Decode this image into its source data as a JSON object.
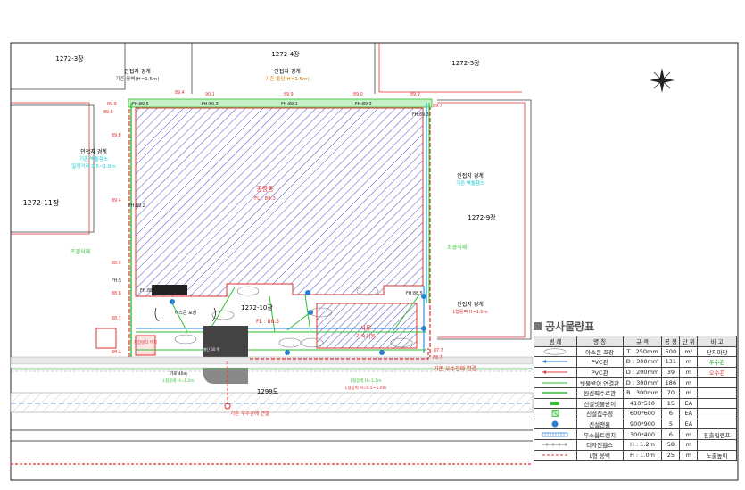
{
  "lots": {
    "lot_3": "1272-3장",
    "lot_4": "1272-4장",
    "lot_5": "1272-5장",
    "lot_11": "1272-11장",
    "lot_9": "1272-9장",
    "lot_10": "1272-10장",
    "road": "1299도"
  },
  "boundaries": {
    "top_center_title": "인접지 경계",
    "top_center_sub": "기존 돌담(H=1.5m)",
    "top_left_title": "인접지 경계",
    "top_left_sub": "기존 옹벽(H=1.5m)",
    "left_title": "인접지 경계",
    "left_sub1": "기존 벽돌휀스",
    "left_sub2": "일정거리 0.5~1.0m",
    "right_title": "인접지 경계",
    "right_sub": "기존 벽돌휀스",
    "right_lower_title": "인접지 경계",
    "right_lower_sub": "L형옹벽 H=1.0m"
  },
  "buildings": {
    "factory_name": "공장동",
    "factory_fl": "FL : 89.3",
    "office_name": "사무",
    "office_sub": "기숙사동",
    "site_fl": "FL : 88.3",
    "ascon": "아스콘 포장",
    "landscape_left": "조경식재",
    "landscape_right": "조경식재",
    "small_box": "저장탱크 부지",
    "drain_connect": "기존 우수관에 연결",
    "drain_bottom": "기존 우수관에 연결",
    "gate_left1": "가로 40m",
    "gate_left2": "L형옹벽 H=1.2m",
    "gate_right1": "L형옹벽 H=1.2m",
    "gate_right2": "L형옹벽 H=0.5~1.0m",
    "stair_note": "계단 60 폭"
  },
  "elevations": {
    "fh_top_left": "FH:89.5",
    "fh_top_2": "FH:89.3",
    "fh_top_3": "FH:89.1",
    "fh_top_4": "FH:89.3",
    "fh_top_right": "FH:89.3",
    "fh_left_mid": "FH:89.2",
    "fh_left_low": "FH:88.8",
    "fh_right_low": "FH:88.5",
    "fh_left_bottom": "FH:5",
    "e1": "89.9",
    "e2": "89.4",
    "e3": "90.1",
    "e4": "89.9",
    "e5": "89.0",
    "e6": "89.9",
    "e7": "89.7",
    "e8": "89.8",
    "e9": "89.8",
    "e10": "89.4",
    "e11": "88.9",
    "e12": "88.8",
    "e13": "88.7",
    "e14": "88.4",
    "e15": "87.7",
    "e16": "88.7"
  },
  "legend": {
    "title": "공사물량표",
    "headers": [
      "범 례",
      "명 칭",
      "규 격",
      "공 정",
      "단 위",
      "비 고"
    ],
    "rows": [
      {
        "symbol": "ascon-hatch",
        "name": "아스콘 포장",
        "spec": "T : 250mm",
        "qty": "500",
        "unit": "m²",
        "note": "단지마당",
        "note_color": "#222"
      },
      {
        "symbol": "pvc-blue",
        "name": "PVC관",
        "spec": "D : 300mm",
        "qty": "131",
        "unit": "m",
        "note": "우수관",
        "note_color": "#2a9d2a"
      },
      {
        "symbol": "pvc-red",
        "name": "PVC관",
        "spec": "D : 200mm",
        "qty": "39",
        "unit": "m",
        "note": "오수관",
        "note_color": "#e04040"
      },
      {
        "symbol": "green-line",
        "name": "빗물받이 연결관",
        "spec": "D : 300mm",
        "qty": "186",
        "unit": "m",
        "note": "",
        "note_color": "#222"
      },
      {
        "symbol": "green-line2",
        "name": "원심력수로관",
        "spec": "B : 300mm",
        "qty": "70",
        "unit": "m",
        "note": "",
        "note_color": "#222"
      },
      {
        "symbol": "green-bar",
        "name": "신설빗물받이",
        "spec": "410*510",
        "qty": "15",
        "unit": "EA",
        "note": "",
        "note_color": "#222"
      },
      {
        "symbol": "green-box",
        "name": "신설집수정",
        "spec": "600*600",
        "qty": "6",
        "unit": "EA",
        "note": "",
        "note_color": "#222"
      },
      {
        "symbol": "blue-circle",
        "name": "신설맨홀",
        "spec": "900*900",
        "qty": "5",
        "unit": "EA",
        "note": "",
        "note_color": "#222"
      },
      {
        "symbol": "blue-grate",
        "name": "무소음트렌치",
        "spec": "300*400",
        "qty": "6",
        "unit": "m",
        "note": "진출입램프",
        "note_color": "#222"
      },
      {
        "symbol": "fence",
        "name": "디자인휀스",
        "spec": "H : 1.2m",
        "qty": "58",
        "unit": "m",
        "note": "",
        "note_color": "#222"
      },
      {
        "symbol": "red-dash",
        "name": "L형 옹벽",
        "spec": "H : 1.0m",
        "qty": "25",
        "unit": "m",
        "note": "노출높이",
        "note_color": "#222"
      }
    ]
  },
  "colors": {
    "hatch": "#5050c8",
    "boundary_red": "#e03030",
    "green": "#2fbf2f",
    "pipe_blue": "#2a7fd4",
    "cyan": "#19c8d6"
  }
}
